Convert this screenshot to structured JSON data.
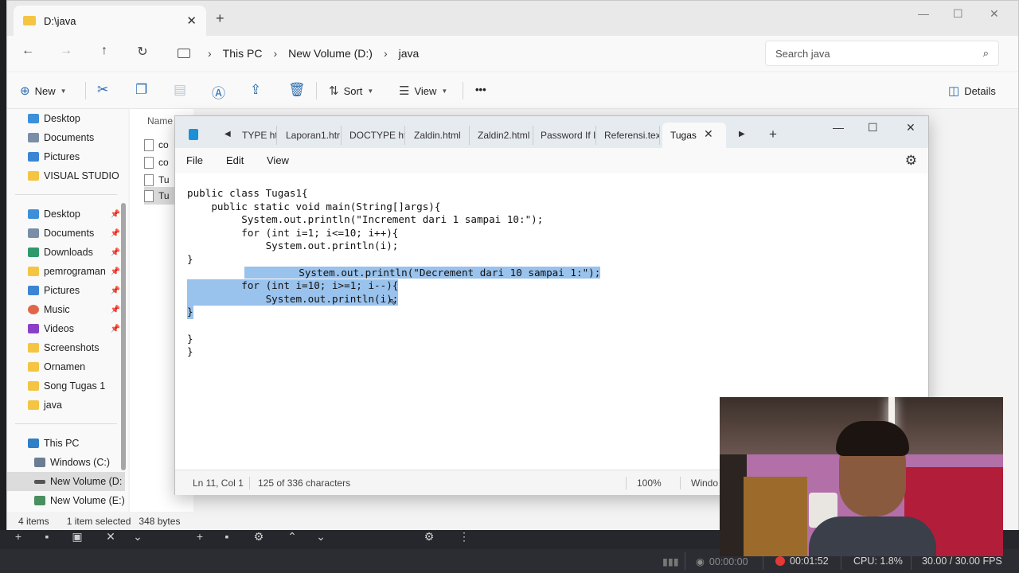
{
  "explorer": {
    "tab_title": "D:\\java",
    "nav": {
      "back": "←",
      "forward": "→",
      "up": "↑",
      "refresh": "↻"
    },
    "breadcrumb": [
      "This PC",
      "New Volume (D:)",
      "java"
    ],
    "search_placeholder": "Search java",
    "commands": {
      "new": "New",
      "sort": "Sort",
      "view": "View",
      "more": "•••",
      "details": "Details"
    },
    "sidebar_top": [
      "Desktop",
      "Documents",
      "Pictures",
      "VISUAL STUDIO"
    ],
    "sidebar_quick": [
      "Desktop",
      "Documents",
      "Downloads",
      "pemrograman",
      "Pictures",
      "Music",
      "Videos",
      "Screenshots",
      "Ornamen",
      "Song Tugas 1",
      "java"
    ],
    "sidebar_pc": [
      "This PC",
      "Windows (C:)",
      "New Volume (D:",
      "New Volume (E:)"
    ],
    "column_name": "Name",
    "files": [
      "co",
      "co",
      "Tu",
      "Tu"
    ],
    "status": {
      "items": "4 items",
      "selected": "1 item selected",
      "size": "348 bytes"
    }
  },
  "notepad": {
    "tabs": [
      "TYPE ht",
      "Laporan1.htr",
      "DOCTYPE ht",
      "Zaldin.html",
      "Zaldin2.html",
      "Password If I",
      "Referensi.tex"
    ],
    "active_tab": "Tugas",
    "menu": [
      "File",
      "Edit",
      "View"
    ],
    "code": [
      "public class Tugas1{",
      "    public static void main(String[]args){",
      "         System.out.println(\"Increment dari 1 sampai 10:\");",
      "         for (int i=1; i<=10; i++){",
      "             System.out.println(i);",
      "}",
      "         System.out.println(\"Decrement dari 10 sampai 1:\");",
      "         for (int i=10; i>=1; i--){",
      "             System.out.println(i);",
      "}",
      "",
      "}",
      "}"
    ],
    "status": {
      "position": "Ln 11, Col 1",
      "chars": "125 of 336 characters",
      "zoom": "100%",
      "eol": "Windo"
    }
  },
  "obs": {
    "stream_time": "00:00:00",
    "rec_time": "00:01:52",
    "cpu": "CPU: 1.8%",
    "fps": "30.00 / 30.00 FPS"
  },
  "colors": {
    "selection": "#99c2ec",
    "accent": "#2b6cb0",
    "record": "#e53935"
  }
}
